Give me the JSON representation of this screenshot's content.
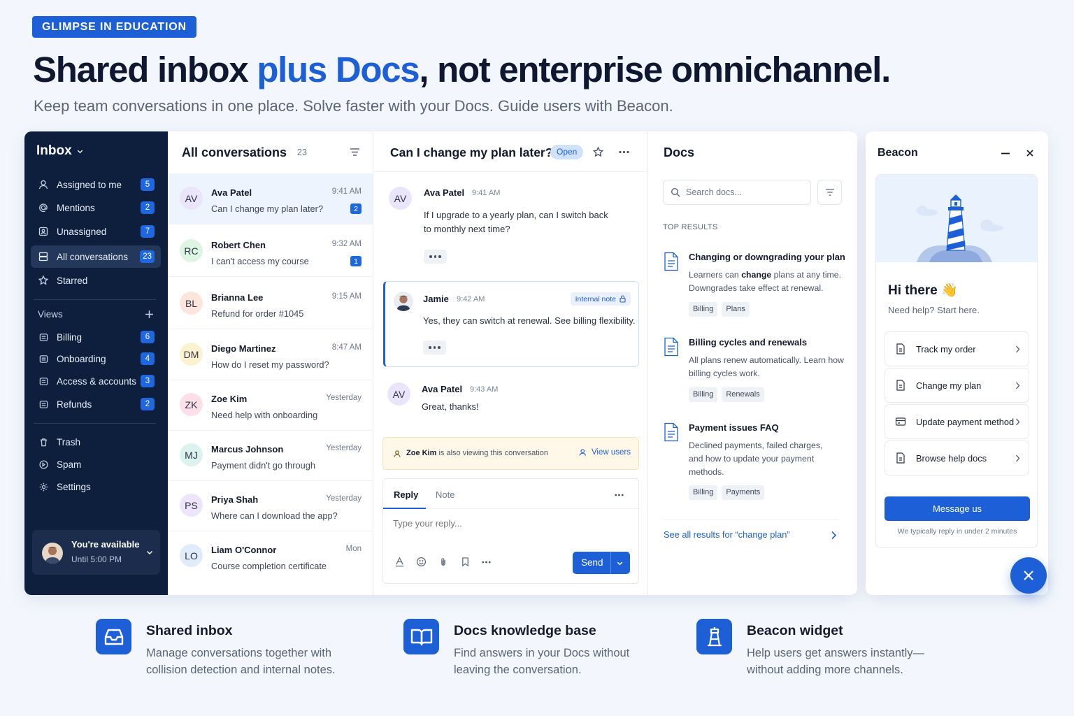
{
  "tag": "GLIMPSE IN EDUCATION",
  "headline": {
    "part1": "Shared inbox ",
    "accent": "plus Docs",
    "part2": ", not enterprise omnichannel."
  },
  "subline": "Keep team conversations in one place. Solve faster with your Docs. Guide users with Beacon.",
  "colors": {
    "brand": "#1d5fd6",
    "sidebar": "#0e1f3d",
    "badge": "#1f67e0"
  },
  "sidebar": {
    "title": "Inbox",
    "items": [
      {
        "label": "Assigned to me",
        "count": "5",
        "icon": "user-icon"
      },
      {
        "label": "Mentions",
        "count": "2",
        "icon": "at-icon"
      },
      {
        "label": "Unassigned",
        "count": "7",
        "icon": "tray-icon"
      },
      {
        "label": "All conversations",
        "count": "23",
        "icon": "inbox-stack-icon"
      },
      {
        "label": "Starred",
        "count": "",
        "icon": "star-icon"
      }
    ],
    "views_label": "Views",
    "views": [
      {
        "label": "Billing",
        "count": "6"
      },
      {
        "label": "Onboarding",
        "count": "4"
      },
      {
        "label": "Access & accounts",
        "count": "3"
      },
      {
        "label": "Refunds",
        "count": "2"
      }
    ],
    "bottom": [
      {
        "label": "Trash",
        "icon": "trash-icon"
      },
      {
        "label": "Spam",
        "icon": "spam-icon"
      },
      {
        "label": "Settings",
        "icon": "gear-icon"
      }
    ],
    "availability": {
      "status": "You're available",
      "until": "Until 5:00 PM"
    }
  },
  "conversations": {
    "title": "All conversations",
    "count": "23",
    "items": [
      {
        "initials": "AV",
        "name": "Ava Patel",
        "snippet": "Can I change my plan later?",
        "time": "9:41 AM",
        "badge": "2",
        "avatar_color": "#ebe5fb"
      },
      {
        "initials": "RC",
        "name": "Robert Chen",
        "snippet": "I can't access my course",
        "time": "9:32 AM",
        "badge": "1",
        "avatar_color": "#dff5e3"
      },
      {
        "initials": "BL",
        "name": "Brianna Lee",
        "snippet": "Refund for order #1045",
        "time": "9:15 AM",
        "badge": "",
        "avatar_color": "#fde5dc"
      },
      {
        "initials": "DM",
        "name": "Diego Martinez",
        "snippet": "How do I reset my password?",
        "time": "8:47 AM",
        "badge": "",
        "avatar_color": "#fdf2cf"
      },
      {
        "initials": "ZK",
        "name": "Zoe Kim",
        "snippet": "Need help with onboarding",
        "time": "Yesterday",
        "badge": "",
        "avatar_color": "#fbe0ea"
      },
      {
        "initials": "MJ",
        "name": "Marcus Johnson",
        "snippet": "Payment didn't go through",
        "time": "Yesterday",
        "badge": "",
        "avatar_color": "#dcf2ee"
      },
      {
        "initials": "PS",
        "name": "Priya Shah",
        "snippet": "Where can I download the app?",
        "time": "Yesterday",
        "badge": "",
        "avatar_color": "#eee5fb"
      },
      {
        "initials": "LO",
        "name": "Liam O'Connor",
        "snippet": "Course completion certificate",
        "time": "Mon",
        "badge": "",
        "avatar_color": "#e1ecfb"
      }
    ]
  },
  "thread": {
    "title": "Can I change my plan later?",
    "status": "Open",
    "messages": [
      {
        "initials": "AV",
        "name": "Ava Patel",
        "time": "9:41 AM",
        "text_line1": "If I upgrade to a yearly plan, can I switch back",
        "text_line2": "to monthly next time?"
      },
      {
        "name": "Jamie",
        "time": "9:42 AM",
        "note_label": "Internal note",
        "text": "Yes, they can switch at renewal. See billing flexibility."
      },
      {
        "initials": "AV",
        "name": "Ava Patel",
        "time": "9:43 AM",
        "text": "Great, thanks!"
      }
    ],
    "collision": {
      "name": "Zoe Kim",
      "text": " is also viewing this conversation",
      "action": "View users"
    },
    "reply": {
      "tab_reply": "Reply",
      "tab_note": "Note",
      "placeholder": "Type your reply...",
      "send": "Send"
    }
  },
  "docs": {
    "title": "Docs",
    "search_placeholder": "Search docs...",
    "results_label": "TOP RESULTS",
    "results": [
      {
        "title": "Changing or downgrading your plan",
        "desc_pre": "Learners can ",
        "desc_bold": "change",
        "desc_post": " plans at any time. Downgrades take effect at renewal.",
        "tags": [
          "Billing",
          "Plans"
        ]
      },
      {
        "title": "Billing cycles and renewals",
        "desc_pre": "All plans renew automatically. Learn how billing cycles work.",
        "desc_bold": "",
        "desc_post": "",
        "tags": [
          "Billing",
          "Renewals"
        ]
      },
      {
        "title": "Payment issues FAQ",
        "desc_pre": "Declined payments, failed charges, and how to update your payment methods.",
        "desc_bold": "",
        "desc_post": "",
        "tags": [
          "Billing",
          "Payments"
        ]
      }
    ],
    "see_all": "See all results for “change plan”"
  },
  "beacon": {
    "title": "Beacon",
    "greeting": "Hi there 👋",
    "help": "Need help? Start here.",
    "options": [
      {
        "label": "Track my order",
        "icon": "document-icon"
      },
      {
        "label": "Change my plan",
        "icon": "document-icon"
      },
      {
        "label": "Update payment method",
        "icon": "card-icon"
      },
      {
        "label": "Browse help docs",
        "icon": "document-icon"
      }
    ],
    "message_button": "Message us",
    "reply_time": "We typically reply in under 2 minutes"
  },
  "features": [
    {
      "title": "Shared inbox",
      "desc": "Manage conversations together with collision detection and internal notes.",
      "icon": "inbox-tray-icon"
    },
    {
      "title": "Docs knowledge base",
      "desc": "Find answers in your Docs without leaving the conversation.",
      "icon": "open-book-icon"
    },
    {
      "title": "Beacon widget",
      "desc": "Help users get answers instantly—without adding more channels.",
      "icon": "lighthouse-icon"
    }
  ]
}
